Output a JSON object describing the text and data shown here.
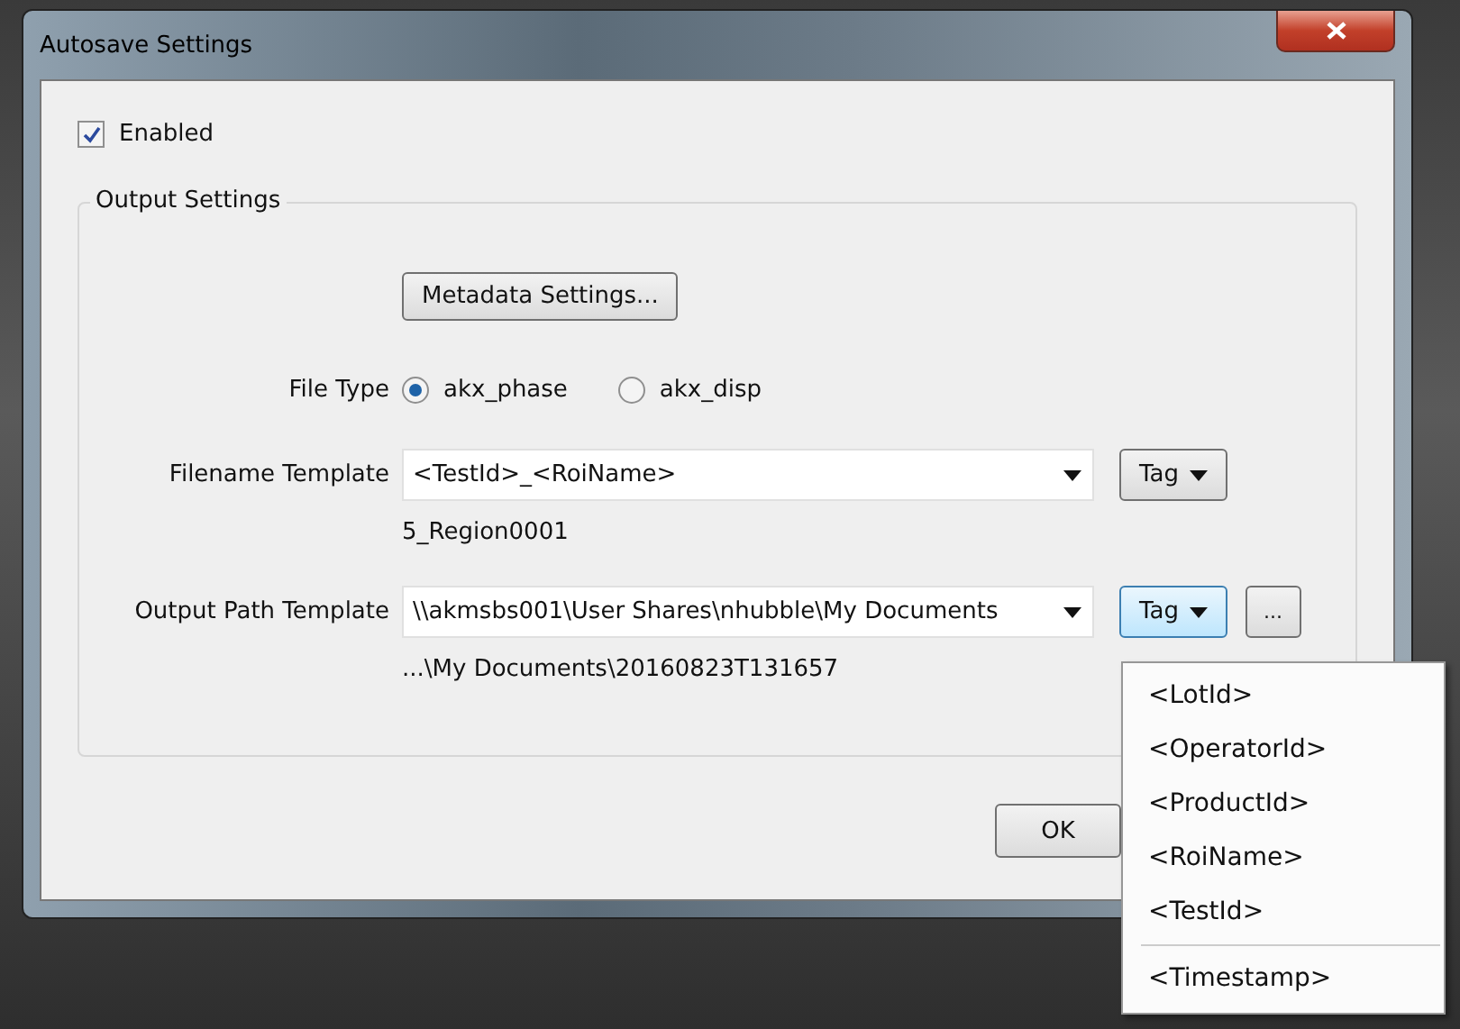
{
  "window": {
    "title": "Autosave Settings"
  },
  "enabled": {
    "label": "Enabled",
    "checked": true
  },
  "output_settings": {
    "title": "Output Settings",
    "metadata_button": "Metadata Settings...",
    "file_type": {
      "label": "File Type",
      "options": [
        {
          "label": "akx_phase",
          "selected": true
        },
        {
          "label": "akx_disp",
          "selected": false
        }
      ]
    },
    "filename_template": {
      "label": "Filename Template",
      "value": "<TestId>_<RoiName>",
      "tag_button": "Tag",
      "tag_open": false,
      "preview": "5_Region0001"
    },
    "output_path_template": {
      "label": "Output Path Template",
      "value": "\\\\akmsbs001\\User Shares\\nhubble\\My Documents",
      "tag_button": "Tag",
      "tag_open": true,
      "browse_button": "...",
      "preview": "...\\My Documents\\20160823T131657"
    }
  },
  "ok_button": "OK",
  "tag_menu": {
    "items": [
      "<LotId>",
      "<OperatorId>",
      "<ProductId>",
      "<RoiName>",
      "<TestId>"
    ],
    "extra_items": [
      "<Timestamp>"
    ]
  }
}
